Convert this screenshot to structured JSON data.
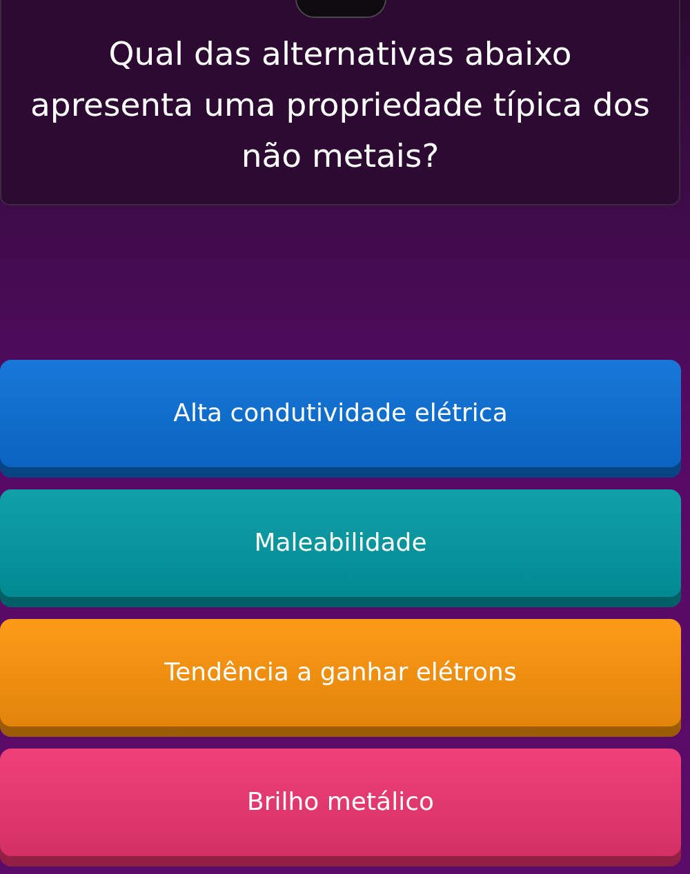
{
  "question": "Qual das alternativas abaixo apresenta uma propriedade típica dos não metais?",
  "options": [
    {
      "label": "Alta condutividade elétrica",
      "color": "#0a6fd6"
    },
    {
      "label": "Maleabilidade",
      "color": "#019aa4"
    },
    {
      "label": "Tendência a ganhar elétrons",
      "color": "#fd940a"
    },
    {
      "label": "Brilho metálico",
      "color": "#ee3570"
    }
  ]
}
